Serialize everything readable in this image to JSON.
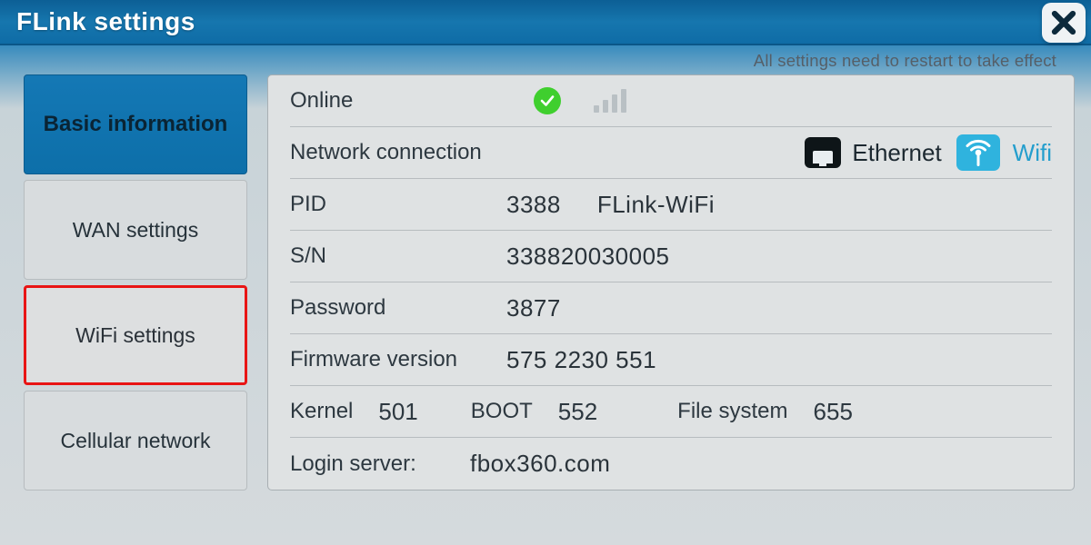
{
  "header": {
    "title": "FLink settings"
  },
  "subnote": "All settings need to restart to take effect",
  "sidebar": {
    "items": [
      {
        "label": "Basic information"
      },
      {
        "label": "WAN settings"
      },
      {
        "label": "WiFi settings"
      },
      {
        "label": "Cellular network"
      }
    ]
  },
  "main": {
    "online_label": "Online",
    "netconn_label": "Network connection",
    "ethernet_label": "Ethernet",
    "wifi_label": "Wifi",
    "pid_label": "PID",
    "pid_value": "3388",
    "pid_model": "FLink-WiFi",
    "sn_label": "S/N",
    "sn_value": "338820030005",
    "password_label": "Password",
    "password_value": "3877",
    "firmware_label": "Firmware version",
    "firmware_value": "575 2230 551",
    "kernel_label": "Kernel",
    "kernel_value": "501",
    "boot_label": "BOOT",
    "boot_value": "552",
    "fs_label": "File system",
    "fs_value": "655",
    "login_label": "Login server:",
    "login_value": "fbox360.com"
  }
}
